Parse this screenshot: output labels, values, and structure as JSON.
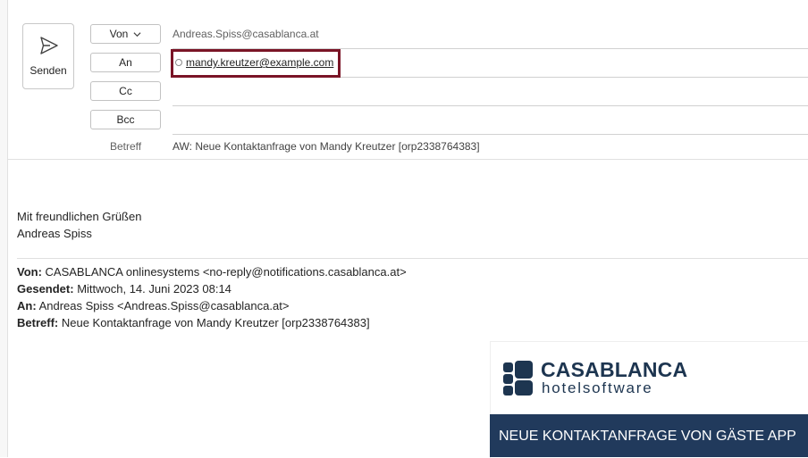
{
  "compose": {
    "send_label": "Senden",
    "from_button": "Von",
    "from_value": "Andreas.Spiss@casablanca.at",
    "to_button": "An",
    "to_recipient": "mandy.kreutzer@example.com",
    "cc_button": "Cc",
    "bcc_button": "Bcc",
    "subject_label": "Betreff",
    "subject_value": "AW: Neue Kontaktanfrage von Mandy Kreutzer [orp2338764383]"
  },
  "body": {
    "greeting": "Mit freundlichen Grüßen",
    "signature_name": "Andreas Spiss"
  },
  "quoted": {
    "from_label": "Von:",
    "from_value": " CASABLANCA onlinesystems <no-reply@notifications.casablanca.at>",
    "sent_label": "Gesendet:",
    "sent_value": " Mittwoch, 14. Juni 2023 08:14",
    "to_label": "An:",
    "to_value": " Andreas Spiss <Andreas.Spiss@casablanca.at>",
    "subject_label": "Betreff:",
    "subject_value": " Neue Kontaktanfrage von Mandy Kreutzer [orp2338764383]"
  },
  "card": {
    "logo_title": "CASABLANCA",
    "logo_subtitle": "hotelsoftware",
    "banner_text": "NEUE KONTAKTANFRAGE VON GÄSTE APP"
  },
  "colors": {
    "highlight_border": "#7a1426",
    "brand_navy": "#1d3550",
    "banner_bg": "#213a5c"
  },
  "icons": {
    "send": "send-icon",
    "from_dropdown": "chevron-down-icon",
    "recipient_presence": "presence-circle-icon",
    "logo": "casablanca-logo-icon"
  }
}
